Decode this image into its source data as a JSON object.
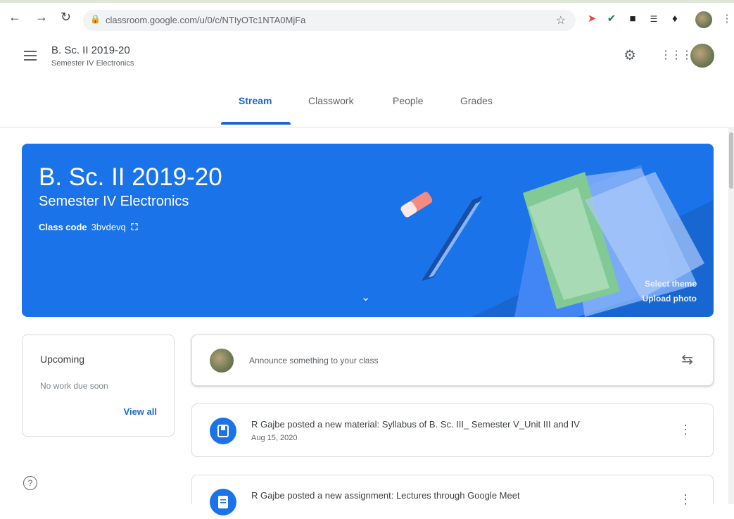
{
  "browser": {
    "url": "classroom.google.com/u/0/c/NTIyOTc1NTA0MjFa",
    "icons": [
      "back-icon",
      "forward-icon",
      "reload-icon",
      "lock-icon",
      "star-icon"
    ]
  },
  "header": {
    "title": "B. Sc. II 2019-20",
    "subtitle": "Semester IV Electronics"
  },
  "tabs": [
    {
      "label": "Stream",
      "active": true
    },
    {
      "label": "Classwork",
      "active": false
    },
    {
      "label": "People",
      "active": false
    },
    {
      "label": "Grades",
      "active": false
    }
  ],
  "banner": {
    "title": "B. Sc. II 2019-20",
    "subtitle": "Semester IV Electronics",
    "class_code_label": "Class code",
    "class_code": "3bvdevq",
    "select_theme": "Select theme",
    "upload_photo": "Upload photo",
    "color": "#1a73e8"
  },
  "upcoming": {
    "title": "Upcoming",
    "text": "No work due soon",
    "view_all": "View all"
  },
  "announce": {
    "placeholder": "Announce something to your class"
  },
  "posts": [
    {
      "title": "R Gajbe posted a new material: Syllabus of B. Sc. III_ Semester V_Unit III and IV",
      "date": "Aug 15, 2020",
      "icon": "material-icon"
    },
    {
      "title": "R Gajbe posted a new assignment: Lectures through Google Meet",
      "icon": "assignment-icon"
    }
  ]
}
